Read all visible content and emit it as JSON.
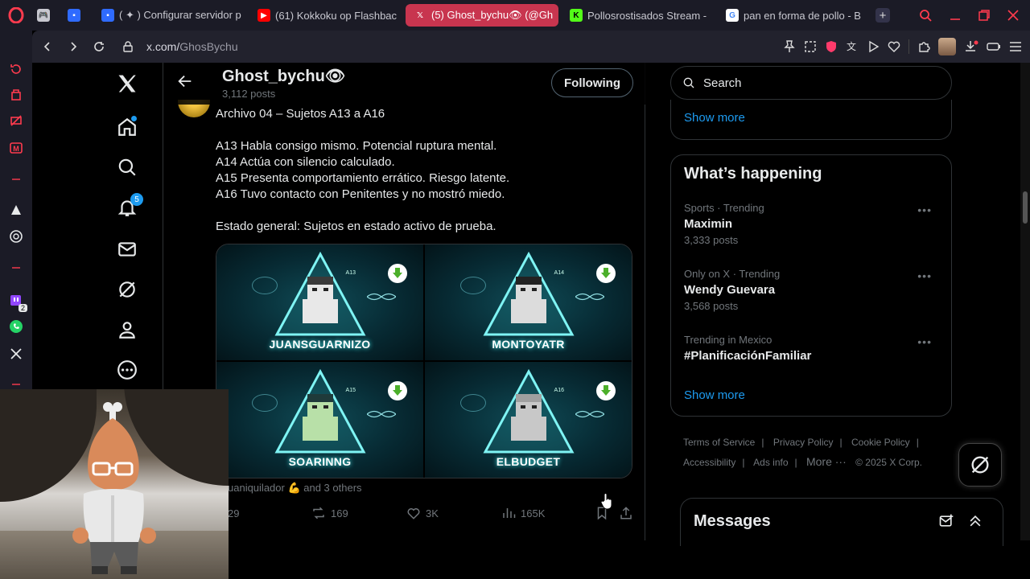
{
  "browser": {
    "tabs": [
      {
        "label": "",
        "icon": "gamepad-icon",
        "color": "#c8c8d0"
      },
      {
        "label": "",
        "icon": "roblox-icon",
        "color": "#2f6bff"
      },
      {
        "label": "( ✦ ) Configurar servidor p",
        "icon": "roblox-icon",
        "color": "#2f6bff"
      },
      {
        "label": "(61) Kokkoku op Flashbac",
        "icon": "youtube-icon",
        "color": "#ff0000"
      },
      {
        "label": "(5) Ghost_bychu👁 (@Gh",
        "icon": "x-icon",
        "color": "#000000",
        "active": true
      },
      {
        "label": "Pollosrostisados Stream -",
        "icon": "kick-icon",
        "color": "#53fc18"
      },
      {
        "label": "pan en forma de pollo - B",
        "icon": "google-icon",
        "color": "#ffffff"
      }
    ],
    "url_domain": "x.com/",
    "url_path": "GhosBychu"
  },
  "sidebar_badges": {
    "twitch_count": "2"
  },
  "profile": {
    "name": "Ghost_bychu👁",
    "posts": "3,112 posts",
    "follow_label": "Following"
  },
  "nav": {
    "notifications_count": "5"
  },
  "tweet": {
    "line1": "Archivo 04 – Sujetos A13 a A16",
    "a13": "A13 Habla consigo mismo. Potencial ruptura mental.",
    "a14": "A14 Actúa con silencio calculado.",
    "a15": "A15 Presenta comportamiento errático. Riesgo latente.",
    "a16": "A16 Tuvo contacto con Penitentes y no mostró miedo.",
    "estado": "Estado general: Sujetos en estado activo de prueba.",
    "media": [
      {
        "code": "A13",
        "name": "JUANSGUARNIZO",
        "skin": "#e8e8e8",
        "hair": "#3a3a3a"
      },
      {
        "code": "A14",
        "name": "MONTOYATR",
        "skin": "#dcdcdc",
        "hair": "#222222"
      },
      {
        "code": "A15",
        "name": "SOARINNG",
        "skin": "#b8e0a8",
        "hair": "#1f3a3a"
      },
      {
        "code": "A16",
        "name": "ELBUDGET",
        "skin": "#c8c8c8",
        "hair": "#a0a0a0"
      }
    ],
    "liked_by": "uaniquilador 💪 and 3 others",
    "replies": "29",
    "reposts": "169",
    "likes": "3K",
    "views": "165K"
  },
  "right": {
    "search_placeholder": "Search",
    "show_more_top": "Show more",
    "happening_title": "What’s happening",
    "trends": [
      {
        "meta": "Sports · Trending",
        "name": "Maximin",
        "count": "3,333 posts"
      },
      {
        "meta": "Only on X · Trending",
        "name": "Wendy Guevara",
        "count": "3,568 posts"
      },
      {
        "meta": "Trending in Mexico",
        "name": "#PlanificaciónFamiliar",
        "count": ""
      }
    ],
    "show_more_bottom": "Show more",
    "footer": {
      "terms": "Terms of Service",
      "privacy": "Privacy Policy",
      "cookie": "Cookie Policy",
      "accessibility": "Accessibility",
      "ads": "Ads info",
      "more": "More ···",
      "copyright": "© 2025 X Corp."
    },
    "messages_title": "Messages"
  }
}
